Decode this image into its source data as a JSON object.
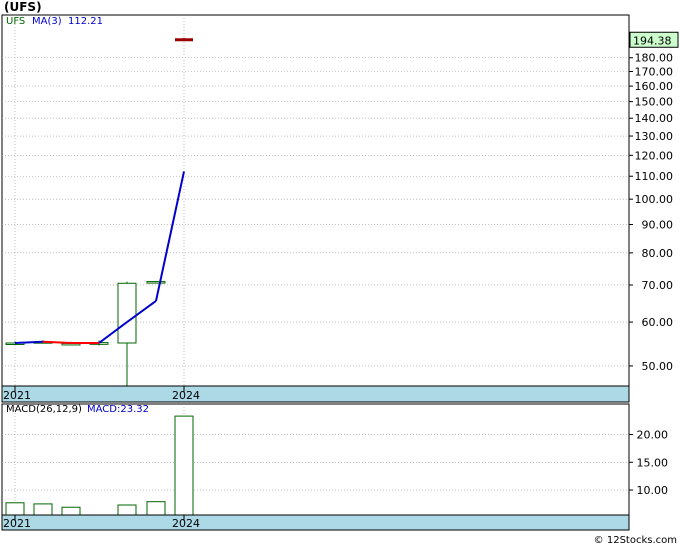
{
  "symbol_title": "(UFS)",
  "footer_credit": "© 12Stocks.com",
  "colors": {
    "price_line": "#0000cc",
    "ma_negative": "#ff0000",
    "candle_up": "#006600",
    "last_price_marker": "#990000",
    "last_price_box": "#ccffcc",
    "band": "#add8e6",
    "grid": "#999999"
  },
  "chart_data": [
    {
      "type": "candlestick",
      "legend": {
        "ticker": "UFS",
        "ma_label": "MA(3)",
        "ma_value": "112.21"
      },
      "x_tick_labels": [
        "2021",
        "2024"
      ],
      "y_scale": "log",
      "ylim": [
        46,
        215
      ],
      "y_ticks": [
        "50.00",
        "60.00",
        "70.00",
        "80.00",
        "90.00",
        "100.00",
        "110.00",
        "120.00",
        "130.00",
        "140.00",
        "150.00",
        "160.00",
        "170.00",
        "180.00"
      ],
      "last_price_label": "194.38",
      "candles": [
        {
          "open": 55.0,
          "high": 55.4,
          "low": 54.8,
          "close": 55.0
        },
        {
          "open": 55.2,
          "high": 55.6,
          "low": 55.0,
          "close": 55.3
        },
        {
          "open": 54.8,
          "high": 55.3,
          "low": 54.6,
          "close": 54.9
        },
        {
          "open": 54.7,
          "high": 55.6,
          "low": 54.4,
          "close": 55.1
        },
        {
          "open": 55.0,
          "high": 71.0,
          "low": 46.0,
          "close": 70.5
        },
        {
          "open": 70.8,
          "high": 71.2,
          "low": 70.5,
          "close": 71.0
        },
        {
          "open": 194.0,
          "high": 195.5,
          "low": 193.0,
          "close": 194.38
        }
      ],
      "ma_series": [
        {
          "x": 0,
          "y": 55.0
        },
        {
          "x": 1,
          "y": 55.3
        },
        {
          "x": 2,
          "y": 55.0
        },
        {
          "x": 3,
          "y": 55.0
        },
        {
          "x": 4,
          "y": 60.0
        },
        {
          "x": 5,
          "y": 65.5
        },
        {
          "x": 6,
          "y": 112.21
        }
      ]
    },
    {
      "type": "bar",
      "legend": {
        "label": "MACD(26,12,9)",
        "macd_label": "MACD:23.32"
      },
      "x_tick_labels": [
        "2021",
        "2024"
      ],
      "ylim": [
        5.5,
        25.5
      ],
      "y_ticks": [
        "10.00",
        "15.00",
        "20.00"
      ],
      "values": [
        7.7,
        7.5,
        6.9,
        null,
        7.3,
        7.9,
        23.32
      ]
    }
  ]
}
